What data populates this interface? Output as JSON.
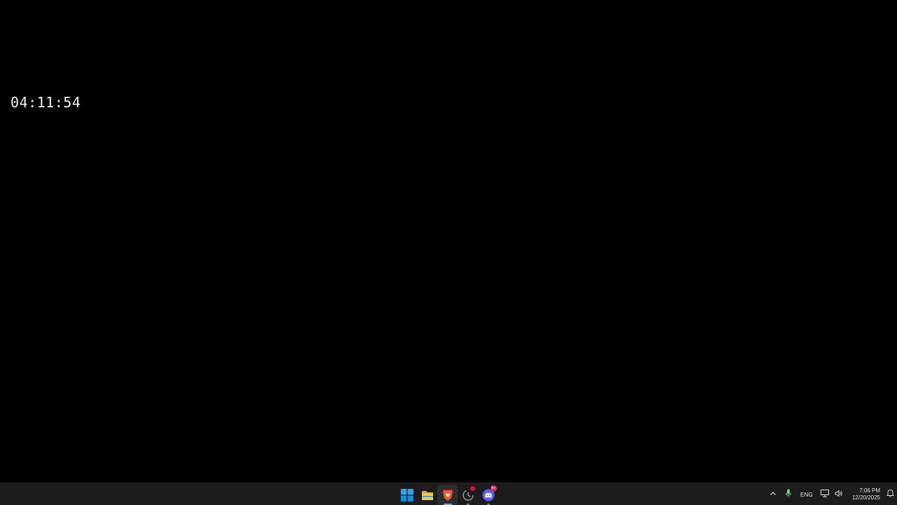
{
  "desktop": {
    "clock_text": "04:11:54"
  },
  "taskbar": {
    "apps": [
      {
        "name": "start",
        "icon": "windows-icon"
      },
      {
        "name": "file-explorer",
        "icon": "folder-icon"
      },
      {
        "name": "brave-browser",
        "icon": "brave-lion-icon",
        "active": true
      },
      {
        "name": "app-loading",
        "icon": "spinner-icon",
        "badge": "dot"
      },
      {
        "name": "discord",
        "icon": "discord-icon",
        "badge": "9+"
      }
    ],
    "tray": {
      "language": "ENG",
      "time": "7:06 PM",
      "date": "12/20/2025",
      "icons": [
        "chevron-up-icon",
        "microphone-icon",
        "network-icon",
        "volume-icon",
        "notification-icon"
      ]
    }
  },
  "colors": {
    "desktop_background": "#000000",
    "taskbar_background": "#1c1c1c",
    "windows_blue": "#29a3ec",
    "folder_yellow": "#f5c748",
    "brave_orange": "#fb542b",
    "discord_blurple": "#5865f2",
    "badge_red": "#e0245e"
  }
}
